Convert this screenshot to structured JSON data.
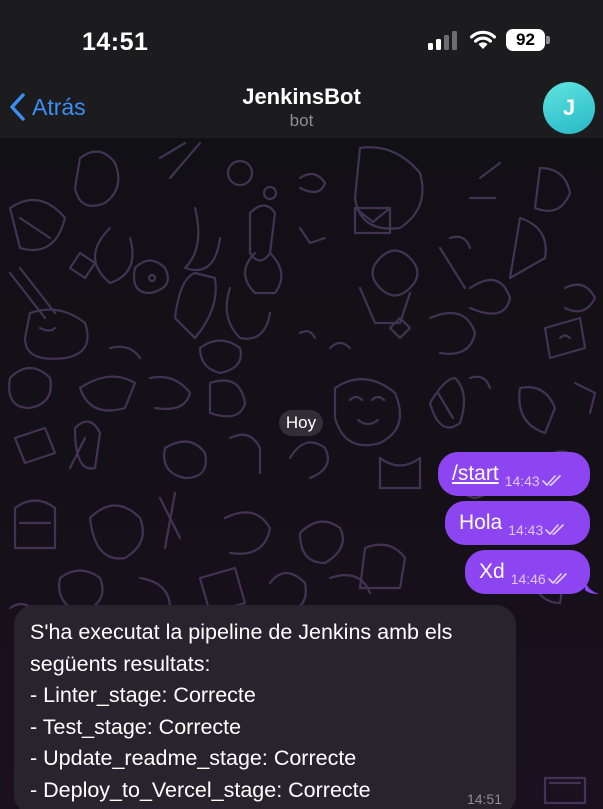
{
  "status_bar": {
    "time": "14:51",
    "battery": "92"
  },
  "header": {
    "back_label": "Atrás",
    "title": "JenkinsBot",
    "subtitle": "bot",
    "avatar_initial": "J"
  },
  "chat": {
    "date_separator": "Hoy",
    "outgoing": [
      {
        "text": "/start",
        "time": "14:43",
        "status": "read"
      },
      {
        "text": "Hola",
        "time": "14:43",
        "status": "read"
      },
      {
        "text": "Xd",
        "time": "14:46",
        "status": "read"
      }
    ],
    "incoming": {
      "lines": [
        "S'ha executat la pipeline de Jenkins amb els",
        "següents resultats:",
        "- Linter_stage: Correcte",
        "- Test_stage: Correcte",
        "- Update_readme_stage: Correcte",
        "- Deploy_to_Vercel_stage: Correcte"
      ],
      "time": "14:51"
    }
  },
  "colors": {
    "accent": "#3a8ff5",
    "outgoing_bubble": "#8c45f0",
    "incoming_bubble": "#27242d",
    "avatar": "#3cc8d2"
  }
}
